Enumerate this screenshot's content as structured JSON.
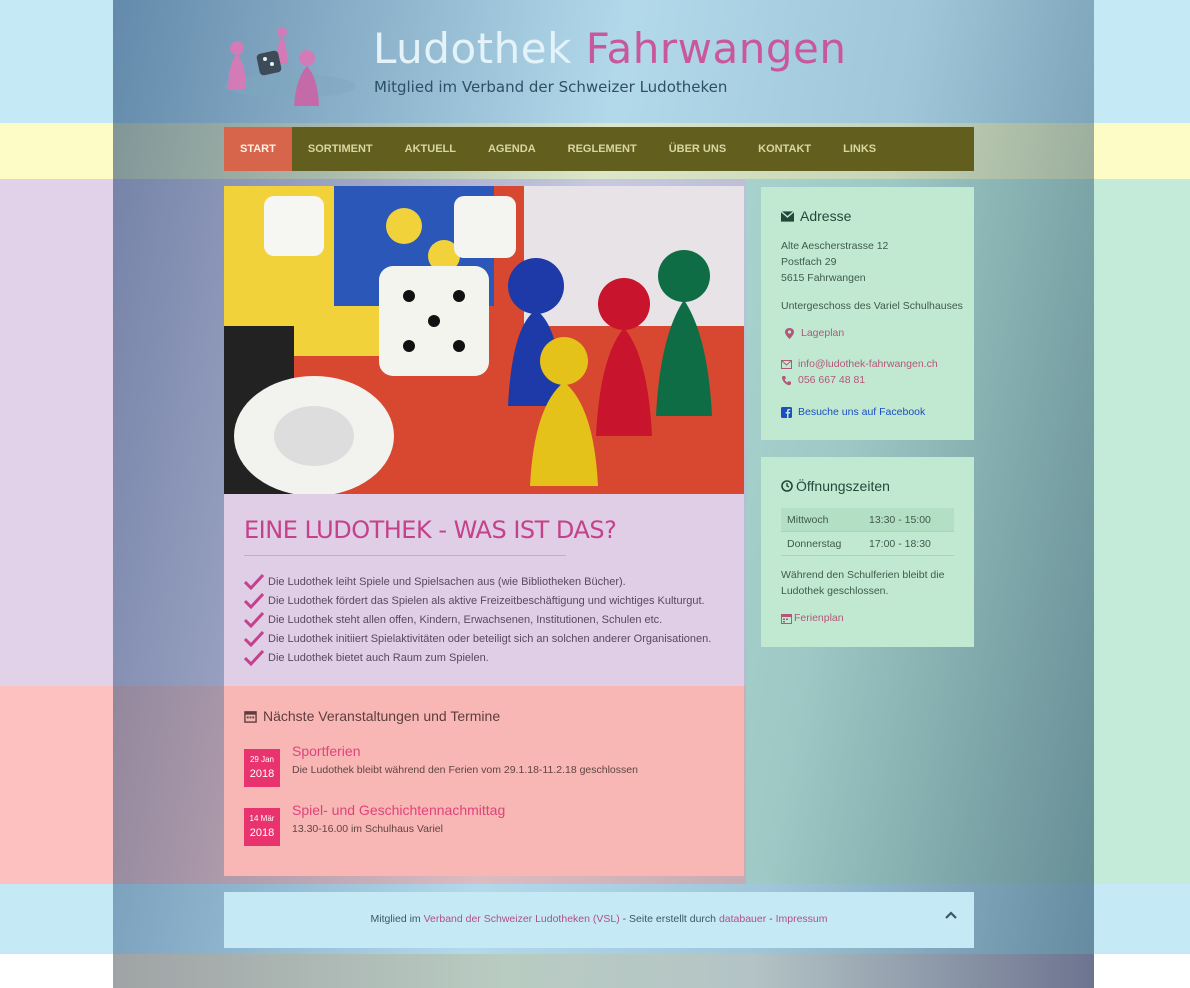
{
  "header": {
    "title_part1": "Ludothek",
    "title_part2": "Fahrwangen",
    "subtitle": "Mitglied im Verband der Schweizer Ludotheken"
  },
  "nav": {
    "items": [
      {
        "label": "START",
        "active": true
      },
      {
        "label": "SORTIMENT"
      },
      {
        "label": "AKTUELL"
      },
      {
        "label": "AGENDA"
      },
      {
        "label": "REGLEMENT"
      },
      {
        "label": "ÜBER UNS"
      },
      {
        "label": "KONTAKT"
      },
      {
        "label": "LINKS"
      }
    ]
  },
  "main": {
    "title": "EINE LUDOTHEK - WAS IST DAS?",
    "points": [
      "Die Ludothek leiht Spiele und Spielsachen aus (wie Bibliotheken Bücher).",
      "Die Ludothek fördert das Spielen als aktive Freizeitbeschäftigung und wichtiges Kulturgut.",
      "Die Ludothek steht allen offen, Kindern, Erwachsenen, Institutionen, Schulen etc.",
      "Die Ludothek initiiert Spielaktivitäten oder beteiligt sich an solchen anderer Organisationen.",
      "Die Ludothek bietet auch Raum zum Spielen."
    ]
  },
  "events": {
    "heading": "Nächste Veranstaltungen und Termine",
    "items": [
      {
        "day": "29 Jan",
        "year": "2018",
        "title": "Sportferien",
        "desc": "Die Ludothek bleibt während den Ferien vom 29.1.18-11.2.18 geschlossen"
      },
      {
        "day": "14 Mär",
        "year": "2018",
        "title": "Spiel- und Geschichtennachmittag",
        "desc": "13.30-16.00 im Schulhaus Variel"
      }
    ]
  },
  "address": {
    "heading": "Adresse",
    "street": "Alte Aescherstrasse 12",
    "postbox": "Postfach 29",
    "city": "5615 Fahrwangen",
    "location_note": "Untergeschoss des Variel Schulhauses",
    "map_link": "Lageplan",
    "email": "info@ludothek-fahrwangen.ch",
    "phone": "056 667 48 81",
    "facebook": "Besuche uns auf Facebook"
  },
  "hours": {
    "heading": "Öffnungszeiten",
    "rows": [
      {
        "day": "Mittwoch",
        "time": "13:30 - 15:00"
      },
      {
        "day": "Donnerstag",
        "time": "17:00 - 18:30"
      }
    ],
    "note": "Während den Schulferien bleibt die Ludothek geschlossen.",
    "holiday_link": "Ferienplan"
  },
  "footer": {
    "prefix": "Mitglied im ",
    "vsl_link": "Verband der Schweizer Ludotheken (VSL)",
    "middle": " - Seite erstellt durch ",
    "author_link": "databauer",
    "sep": " - ",
    "impressum_link": "Impressum"
  },
  "colors": {
    "accent_pink": "#c4418c",
    "nav_active": "#d6654b",
    "event_badge": "#e8336e"
  }
}
